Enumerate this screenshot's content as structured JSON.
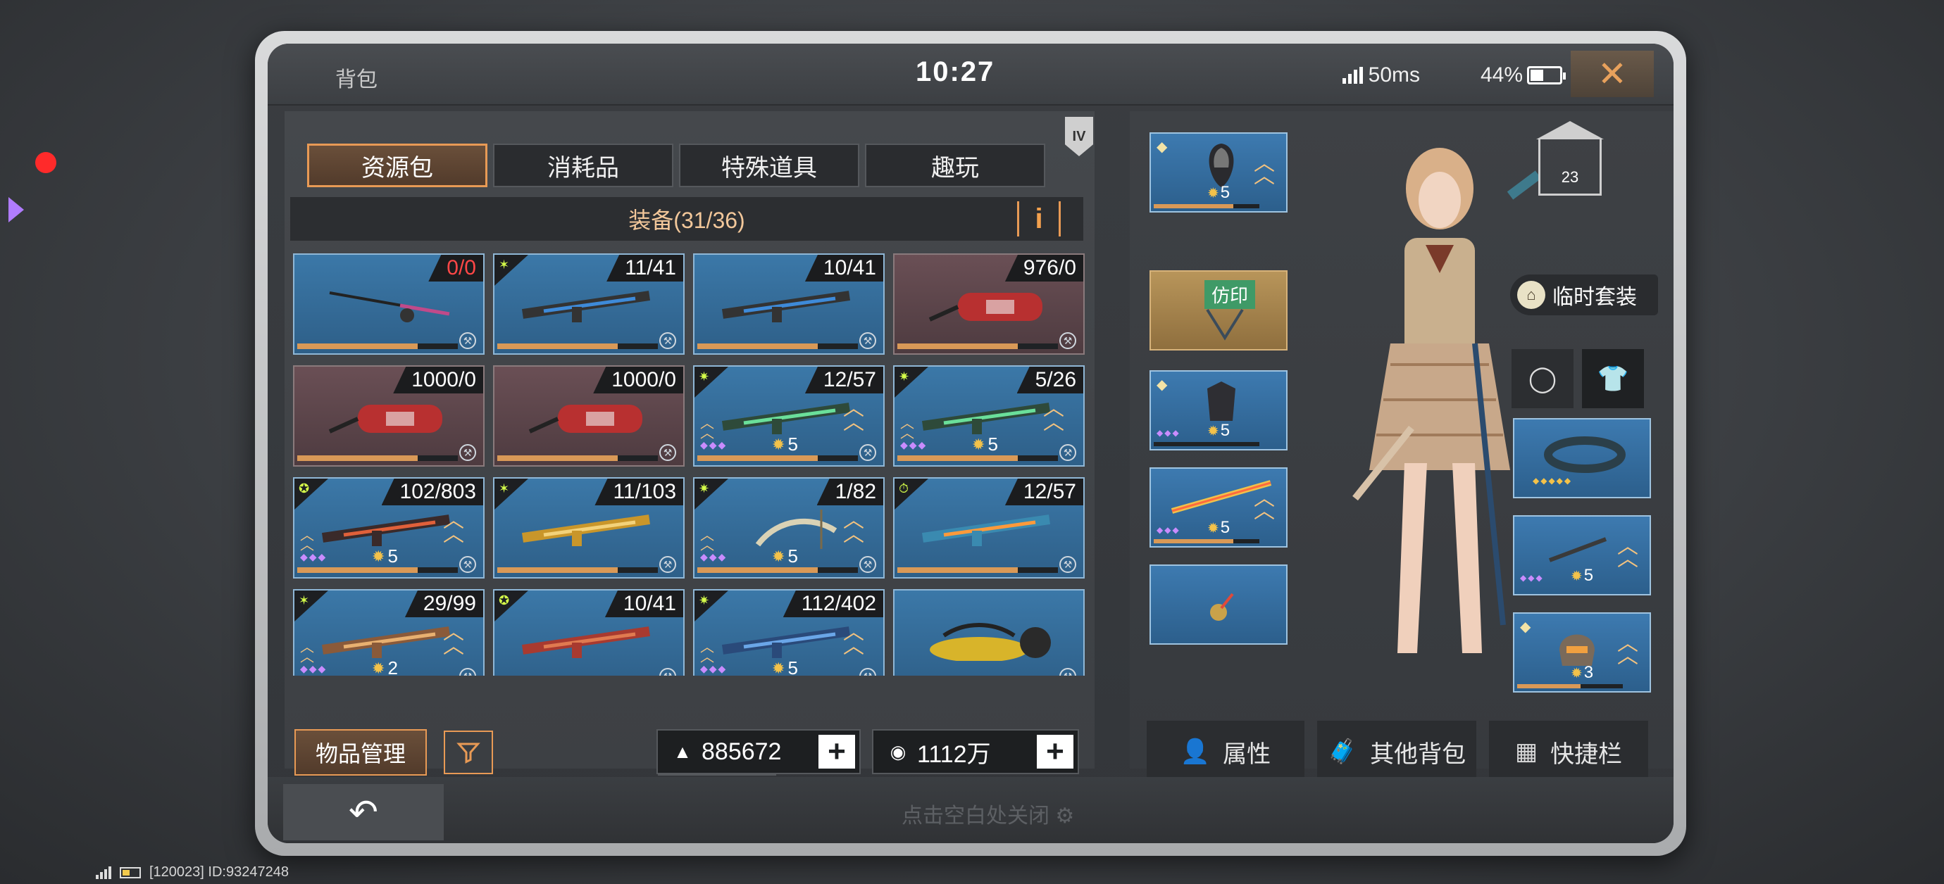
{
  "status": {
    "title": "背包",
    "time": "10:27",
    "ping": "50ms",
    "battery": "44%"
  },
  "tabs": [
    {
      "label": "资源包",
      "active": true
    },
    {
      "label": "消耗品",
      "active": false
    },
    {
      "label": "特殊道具",
      "active": false
    },
    {
      "label": "趣玩",
      "active": false
    }
  ],
  "tier_badge": "IV",
  "equipment_header": "装备(31/36)",
  "info_icon_label": "i",
  "items": [
    {
      "count": "0/0",
      "alert": true,
      "theme": "blue",
      "icon": "fishing-rod",
      "rarity_icon": "",
      "level": "",
      "progress": 0.75
    },
    {
      "count": "11/41",
      "theme": "blue",
      "icon": "sniper-rifle",
      "rarity_icon": "claw",
      "level": "",
      "progress": 0.75
    },
    {
      "count": "10/41",
      "theme": "blue",
      "icon": "sniper-rifle",
      "rarity_icon": "",
      "level": "",
      "progress": 0.75
    },
    {
      "count": "976/0",
      "theme": "red",
      "icon": "extinguisher",
      "rarity_icon": "",
      "level": "",
      "progress": 0.75
    },
    {
      "count": "1000/0",
      "theme": "red",
      "icon": "extinguisher",
      "rarity_icon": "",
      "level": "",
      "progress": 0.75
    },
    {
      "count": "1000/0",
      "theme": "red",
      "icon": "extinguisher",
      "rarity_icon": "",
      "level": "",
      "progress": 0.75
    },
    {
      "count": "12/57",
      "theme": "blue",
      "icon": "heavy-gun",
      "rarity_icon": "spark",
      "level": "5",
      "progress": 0.75
    },
    {
      "count": "5/26",
      "theme": "blue",
      "icon": "heavy-gun",
      "rarity_icon": "spark",
      "level": "5",
      "progress": 0.75
    },
    {
      "count": "102/803",
      "theme": "blue",
      "icon": "dual-gun",
      "rarity_icon": "orb",
      "level": "5",
      "progress": 0.75
    },
    {
      "count": "11/103",
      "theme": "blue",
      "icon": "gold-pistols",
      "rarity_icon": "claw",
      "level": "",
      "progress": 0.75
    },
    {
      "count": "1/82",
      "theme": "blue",
      "icon": "bow",
      "rarity_icon": "spark",
      "level": "5",
      "progress": 0.75
    },
    {
      "count": "12/57",
      "theme": "blue",
      "icon": "flame-gun",
      "rarity_icon": "timer",
      "level": "",
      "progress": 0.75
    },
    {
      "count": "29/99",
      "theme": "blue",
      "icon": "rifle",
      "rarity_icon": "claw",
      "level": "2",
      "progress": 0.75
    },
    {
      "count": "10/41",
      "theme": "blue",
      "icon": "red-rifle",
      "rarity_icon": "orb",
      "level": "",
      "progress": 0.75
    },
    {
      "count": "112/402",
      "theme": "blue",
      "icon": "blue-rifle",
      "rarity_icon": "spark",
      "level": "5",
      "progress": 0.75
    },
    {
      "count": "",
      "theme": "blue",
      "icon": "scooter",
      "rarity_icon": "",
      "level": "",
      "progress": 0
    }
  ],
  "manage_button": "物品管理",
  "filter_icon": "filter-icon",
  "currency": [
    {
      "icon": "ingot-icon",
      "value": "885672"
    },
    {
      "icon": "coin-icon",
      "value": "1112万"
    }
  ],
  "right": {
    "slots": [
      {
        "name": "head-slot",
        "level": "5"
      },
      {
        "name": "imprint-slot",
        "tag": "仿印"
      },
      {
        "name": "armor-slot",
        "level": "5"
      },
      {
        "name": "weapon-slot",
        "level": "5"
      },
      {
        "name": "mini-slot",
        "level": ""
      },
      {
        "name": "ring-slot",
        "level": ""
      },
      {
        "name": "accessory-slot",
        "level": "5"
      },
      {
        "name": "helmet-slot",
        "level": "3"
      }
    ],
    "char_level": "23",
    "temp_outfit": "临时套装",
    "buttons": [
      {
        "label": "属性",
        "icon": "person-icon"
      },
      {
        "label": "其他背包",
        "icon": "bag-icon"
      },
      {
        "label": "快捷栏",
        "icon": "grid-gear-icon"
      }
    ]
  },
  "footer": {
    "hint": "点击空白处关闭",
    "id_text": "[120023] ID:93247248"
  }
}
